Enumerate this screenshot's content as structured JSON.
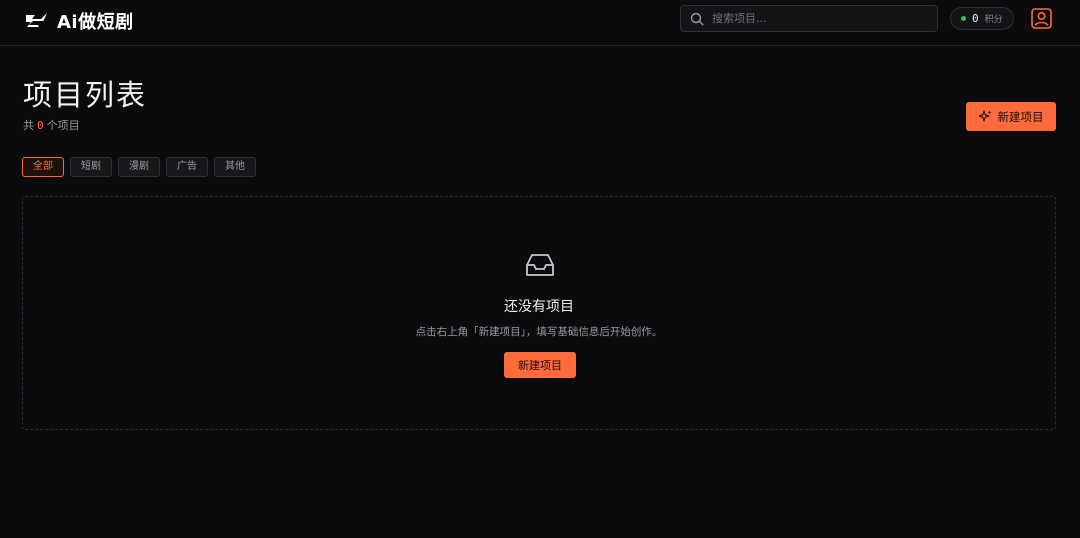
{
  "app": {
    "logo_text": "Ai做短剧",
    "logo_icon": "bolt-wing-logo"
  },
  "header": {
    "search_placeholder": "搜索项目...",
    "points_value": "0",
    "points_unit": "积分",
    "points_status_color": "#22c55e",
    "avatar_icon": "user-icon"
  },
  "main": {
    "title": "项目列表",
    "subtitle_prefix": "共",
    "project_count": "0",
    "subtitle_suffix": "个项目",
    "new_project_label": "新建项目",
    "filters": [
      {
        "label": "全部",
        "active": true
      },
      {
        "label": "短剧",
        "active": false
      },
      {
        "label": "漫剧",
        "active": false
      },
      {
        "label": "广告",
        "active": false
      },
      {
        "label": "其他",
        "active": false
      }
    ]
  },
  "empty_state": {
    "icon": "inbox-icon",
    "title": "还没有项目",
    "description": "点击右上角「新建项目」，填写基础信息后开始创作。",
    "button_label": "新建项目"
  },
  "colors": {
    "accent": "#ff6a3d",
    "background": "#0b0b0d"
  }
}
